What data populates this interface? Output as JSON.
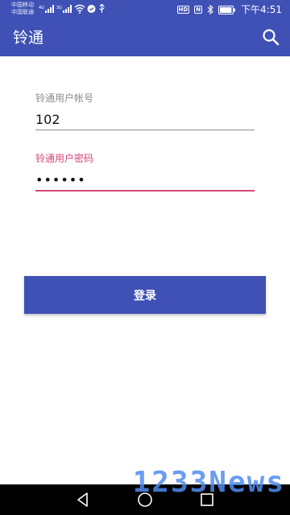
{
  "status_bar": {
    "carrier_1": "中国移动",
    "carrier_2": "中国联通",
    "net_1": "4G",
    "net_2": "3G",
    "hd_badge": "HD",
    "nfc_badge": "N",
    "time": "下午4:51",
    "battery_level": 0.9
  },
  "toolbar": {
    "title": "铃通",
    "background": "#3f51b5"
  },
  "form": {
    "account_label": "铃通用户帐号",
    "account_value": "102",
    "password_label": "铃通用户密码",
    "password_value": "••••••",
    "accent_color": "#d6457b"
  },
  "login_button": {
    "label": "登录"
  },
  "nav": {
    "back": "back-icon",
    "home": "home-icon",
    "recents": "recents-icon"
  },
  "watermark": {
    "text": "1233News"
  }
}
